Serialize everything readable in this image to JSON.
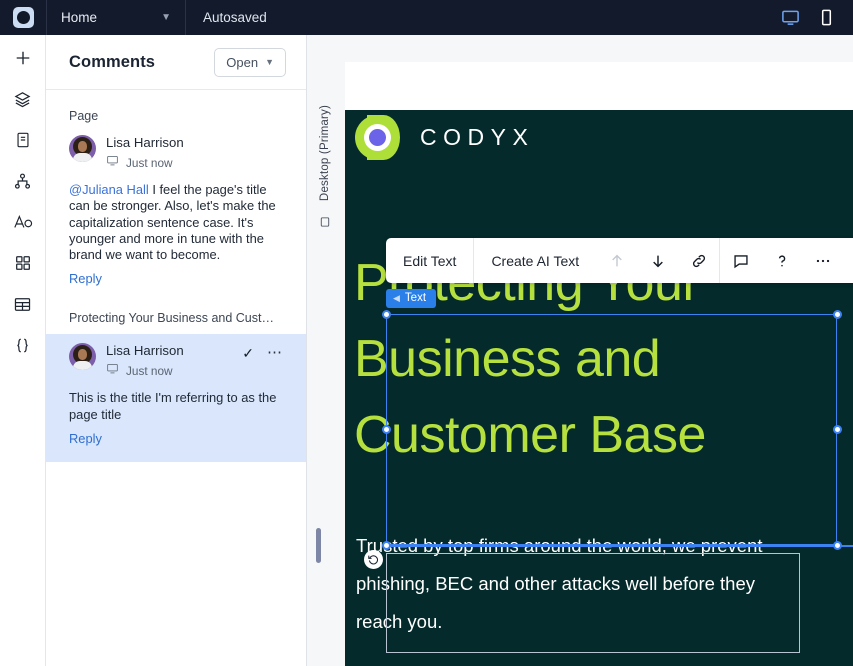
{
  "topbar": {
    "logo_icon": "app-logo-icon",
    "home_label": "Home",
    "home_chevron": "chevron-down-icon",
    "autosaved_label": "Autosaved",
    "desktop_icon": "desktop-view-icon",
    "mobile_icon": "mobile-view-icon"
  },
  "rail": {
    "items": [
      {
        "icon": "plus-icon",
        "name": "add"
      },
      {
        "icon": "layers-icon",
        "name": "layers"
      },
      {
        "icon": "page-icon",
        "name": "pages"
      },
      {
        "icon": "sitemap-icon",
        "name": "sitemap"
      },
      {
        "icon": "typography-icon",
        "name": "typography"
      },
      {
        "icon": "components-icon",
        "name": "components"
      },
      {
        "icon": "table-icon",
        "name": "table"
      },
      {
        "icon": "code-icon",
        "name": "code"
      }
    ]
  },
  "panel": {
    "title": "Comments",
    "filter_label": "Open",
    "filter_chevron": "chevron-down-icon",
    "sections": [
      {
        "label": "Page",
        "selected": false,
        "comment": {
          "author": "Lisa Harrison",
          "device_icon": "desktop-icon",
          "timestamp": "Just now",
          "mention": "@Juliana Hall",
          "body": " I feel the page's title can be stronger. Also, let's make the capitalization sentence case. It's younger and more in tune with the brand we want to become.",
          "reply_label": "Reply"
        }
      },
      {
        "label": "Protecting Your Business and Cust…",
        "selected": true,
        "comment": {
          "author": "Lisa Harrison",
          "device_icon": "desktop-icon",
          "timestamp": "Just now",
          "mention": "",
          "body": "This is the title I'm referring to as the page title",
          "reply_label": "Reply",
          "resolve_icon": "check-icon",
          "more_icon": "more-horizontal-icon"
        }
      }
    ]
  },
  "canvas": {
    "device_label": "Desktop (Primary)",
    "device_icon": "monitor-icon",
    "scrollbar": "vertical-scrollbar",
    "toolbar": {
      "edit_text_label": "Edit Text",
      "create_ai_text_label": "Create AI Text",
      "icons": [
        {
          "name": "arrow-up-icon",
          "disabled": true
        },
        {
          "name": "arrow-down-icon",
          "disabled": false
        },
        {
          "name": "link-icon",
          "disabled": false
        },
        {
          "name": "comment-icon",
          "disabled": false
        },
        {
          "name": "help-icon",
          "disabled": false
        },
        {
          "name": "more-horizontal-icon",
          "disabled": false
        }
      ]
    },
    "selection_tag": {
      "chevron": "chevron-left-icon",
      "label": "Text"
    },
    "revert_icon": "revert-icon",
    "page": {
      "brand_name": "CODYX",
      "brand_mark": "codyx-logo-icon",
      "heading": "Protecting Your Business and Customer Base",
      "paragraph": "Trusted by top firms around the world, we prevent phishing, BEC and other attacks well before they reach you."
    }
  },
  "colors": {
    "topbar_bg": "#131a2b",
    "accent_blue": "#3d82f2",
    "selected_comment_bg": "#d9e6fb",
    "link_blue": "#2f6fd0",
    "page_dark": "#042a2b",
    "heading_green": "#b6e03d",
    "brand_green": "#aede38",
    "brand_purple": "#6b63e8",
    "tag_blue": "#2a7fe8"
  }
}
